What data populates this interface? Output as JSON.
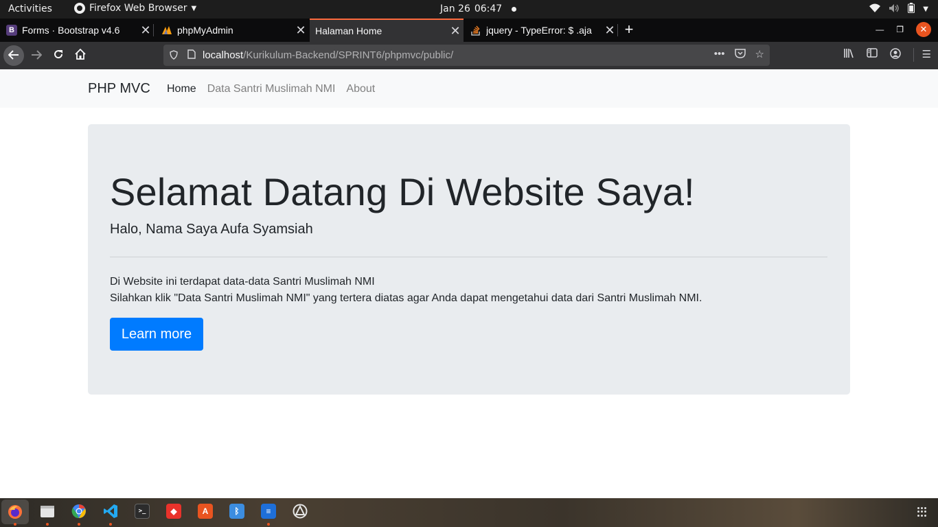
{
  "topbar": {
    "activities": "Activities",
    "app_name": "Firefox Web Browser",
    "date": "Jan 26",
    "time": "06:47"
  },
  "tabs": [
    {
      "title": "Forms · Bootstrap v4.6",
      "favicon": "B",
      "favicon_color": "#563d7c"
    },
    {
      "title": "phpMyAdmin",
      "favicon": "phpmyadmin-icon",
      "favicon_color": "#f89c0e"
    },
    {
      "title": "Halaman Home",
      "active": true
    },
    {
      "title": "jquery - TypeError: $ .aja",
      "favicon": "stackoverflow-icon",
      "favicon_color": "#f48024"
    }
  ],
  "urlbar": {
    "host": "localhost",
    "path": "/Kurikulum-Backend/SPRINT6/phpmvc/public/"
  },
  "site": {
    "brand": "PHP MVC",
    "nav": [
      {
        "label": "Home",
        "active": true
      },
      {
        "label": "Data Santri Muslimah NMI",
        "active": false
      },
      {
        "label": "About",
        "active": false
      }
    ]
  },
  "jumbotron": {
    "heading": "Selamat Datang Di Website Saya!",
    "lead": "Halo, Nama Saya Aufa Syamsiah",
    "paragraph1": "Di Website ini terdapat data-data Santri Muslimah NMI",
    "paragraph2": "Silahkan klik \"Data Santri Muslimah NMI\" yang tertera diatas agar Anda dapat mengetahui data dari Santri Muslimah NMI.",
    "button": "Learn more"
  },
  "colors": {
    "primary": "#007bff",
    "jumbotron_bg": "#e9ecef",
    "navbar_bg": "#f8f9fa",
    "active_tab_accent": "#ff6a3d"
  }
}
